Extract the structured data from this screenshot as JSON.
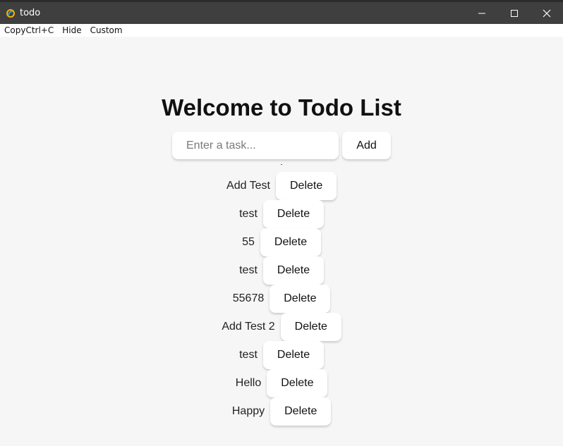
{
  "window": {
    "title": "todo",
    "minimize_glyph": "—",
    "maximize_glyph": "☐",
    "close_glyph": "✕"
  },
  "menu": {
    "items": [
      "CopyCtrl+C",
      "Hide",
      "Custom"
    ]
  },
  "page": {
    "title": "Welcome to Todo List",
    "input_placeholder": "Enter a task...",
    "input_value": "",
    "add_label": "Add",
    "delete_label": "Delete"
  },
  "todos": [
    "Add Test",
    "test",
    "55",
    "test",
    "55678",
    "Add Test 2",
    "test",
    "Hello",
    "Happy"
  ],
  "colors": {
    "titlebar": "#3f3f3f",
    "background": "#f6f6f6",
    "button": "#ffffff"
  }
}
